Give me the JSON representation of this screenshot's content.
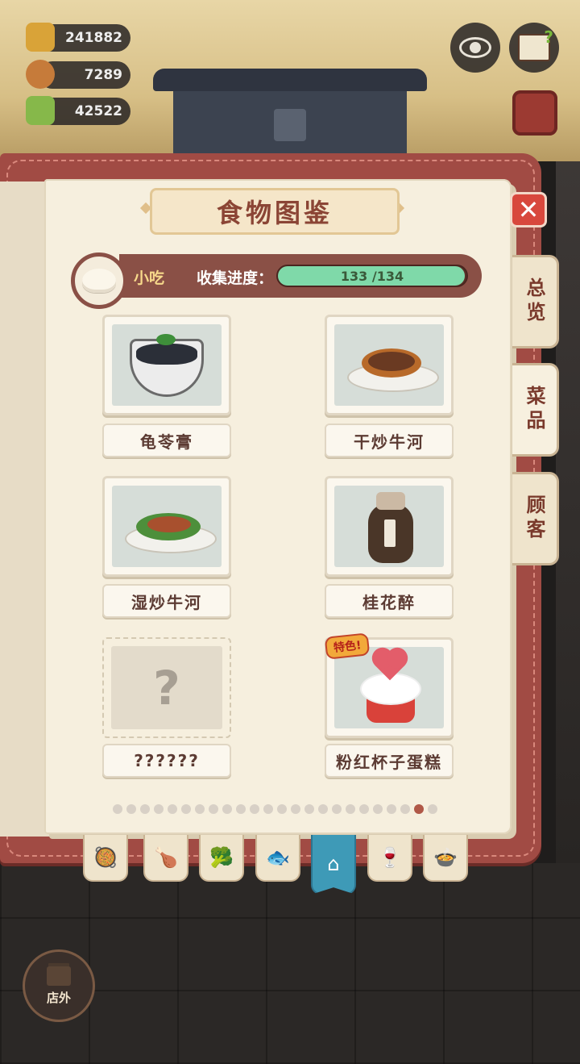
{
  "resources": [
    {
      "value": "241882",
      "icon": "gold-ingot-icon"
    },
    {
      "value": "7289",
      "icon": "chef-hat-icon"
    },
    {
      "value": "42522",
      "icon": "green-ticket-icon"
    }
  ],
  "title": "食物图鉴",
  "category": {
    "name": "小吃",
    "progress_label": "收集进度：",
    "collected": 133,
    "total": 134,
    "progress_text": "133 /134",
    "progress_color": "#7fd9a9"
  },
  "side_tabs": [
    "总览",
    "菜品",
    "顾客"
  ],
  "items": [
    {
      "name": "龟苓膏",
      "locked": false,
      "special": false,
      "icon": "herbal-jelly-bowl-icon"
    },
    {
      "name": "干炒牛河",
      "locked": false,
      "special": false,
      "icon": "dry-fried-beef-noodles-icon"
    },
    {
      "name": "湿炒牛河",
      "locked": false,
      "special": false,
      "icon": "wet-fried-beef-noodles-icon"
    },
    {
      "name": "桂花醉",
      "locked": false,
      "special": false,
      "icon": "osmanthus-wine-jar-icon"
    },
    {
      "name": "??????",
      "locked": true,
      "special": false,
      "icon": "question-mark-icon"
    },
    {
      "name": "粉红杯子蛋糕",
      "locked": false,
      "special": true,
      "badge": "特色!",
      "icon": "pink-cupcake-icon"
    }
  ],
  "pagination": {
    "total": 24,
    "current": 23
  },
  "bottom_tabs": [
    {
      "icon": "wok-icon",
      "active": false
    },
    {
      "icon": "drumstick-icon",
      "active": false
    },
    {
      "icon": "broccoli-icon",
      "active": false
    },
    {
      "icon": "fish-icon",
      "active": false
    },
    {
      "icon": "bun-icon",
      "active": true
    },
    {
      "icon": "wine-glass-icon",
      "active": false
    },
    {
      "icon": "soup-bowl-icon",
      "active": false
    }
  ],
  "store_button": "店外",
  "colors": {
    "accent": "#a14b44",
    "active_tab": "#3e9ab7",
    "page": "#f6efde"
  }
}
